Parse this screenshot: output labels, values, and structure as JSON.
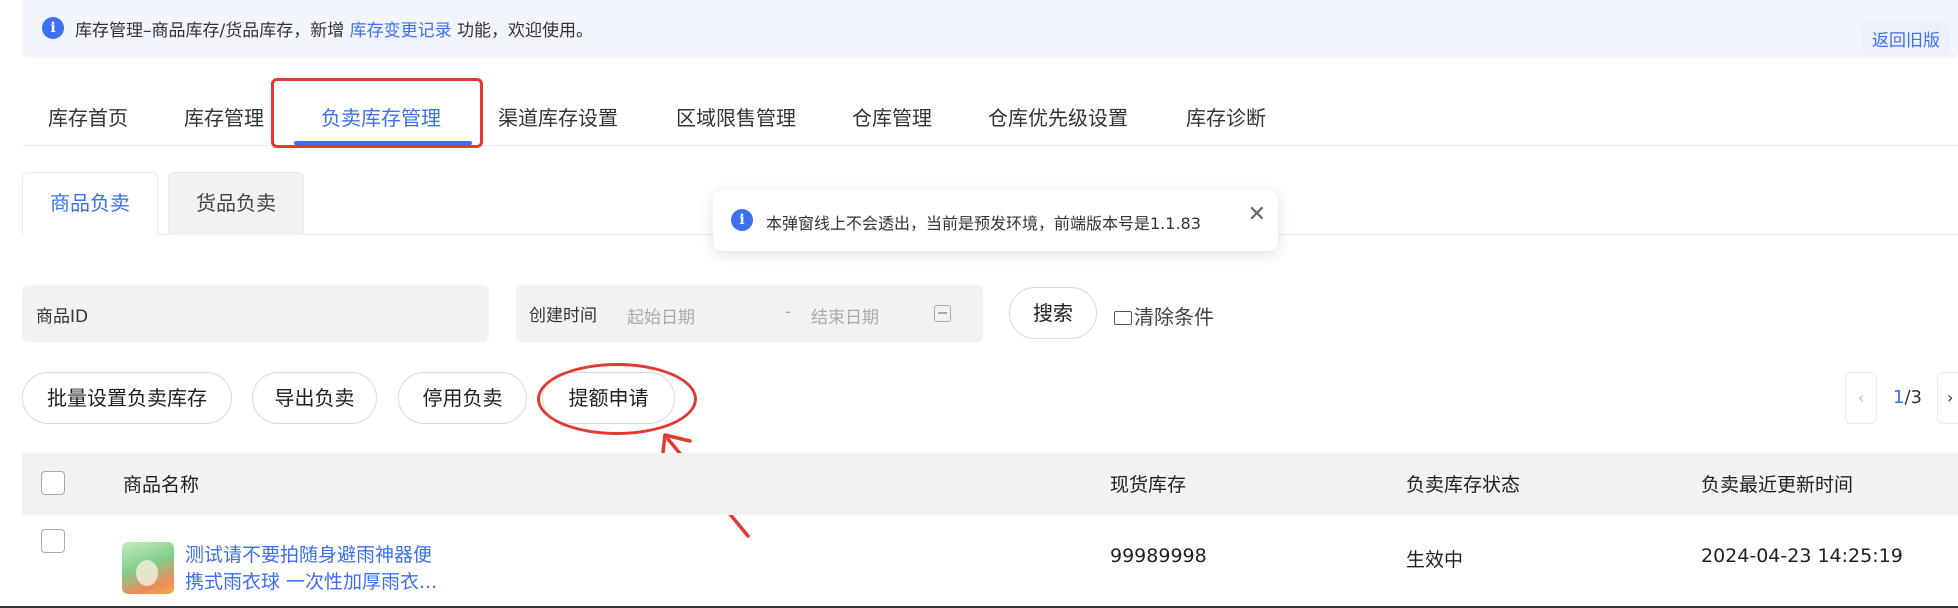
{
  "notice": {
    "text_before": "库存管理–商品库存/货品库存，新增",
    "link": "库存变更记录",
    "text_after": "功能，欢迎使用。",
    "back_button": "返回旧版"
  },
  "main_tabs": [
    {
      "label": "库存首页",
      "active": false
    },
    {
      "label": "库存管理",
      "active": false
    },
    {
      "label": "负卖库存管理",
      "active": true
    },
    {
      "label": "渠道库存设置",
      "active": false
    },
    {
      "label": "区域限售管理",
      "active": false
    },
    {
      "label": "仓库管理",
      "active": false
    },
    {
      "label": "仓库优先级设置",
      "active": false
    },
    {
      "label": "库存诊断",
      "active": false
    }
  ],
  "sub_tabs": [
    {
      "label": "商品负卖",
      "active": true
    },
    {
      "label": "货品负卖",
      "active": false
    }
  ],
  "toast": {
    "text": "本弹窗线上不会透出，当前是预发环境，前端版本号是1.1.83"
  },
  "filters": {
    "product_id_label": "商品ID",
    "created_time_label": "创建时间",
    "start_placeholder": "起始日期",
    "separator": "-",
    "end_placeholder": "结束日期",
    "search_button": "搜索",
    "clear_button": "清除条件"
  },
  "actions": {
    "batch_set": "批量设置负卖库存",
    "export": "导出负卖",
    "disable": "停用负卖",
    "quota_apply": "提额申请"
  },
  "pager": {
    "current": "1",
    "total": "/3"
  },
  "table": {
    "headers": [
      "商品名称",
      "现货库存",
      "负卖库存状态",
      "负卖最近更新时间"
    ],
    "rows": [
      {
        "name_line1": "测试请不要拍随身避雨神器便",
        "name_line2": "携式雨衣球 一次性加厚雨衣...",
        "stock": "99989998",
        "status": "生效中",
        "updated": "2024-04-23 14:25:19"
      }
    ]
  },
  "colors": {
    "primary": "#3d6ff2",
    "annotation": "#e23a32",
    "notice_bg": "#f3f5fd",
    "table_header_bg": "#f2f2f3"
  }
}
